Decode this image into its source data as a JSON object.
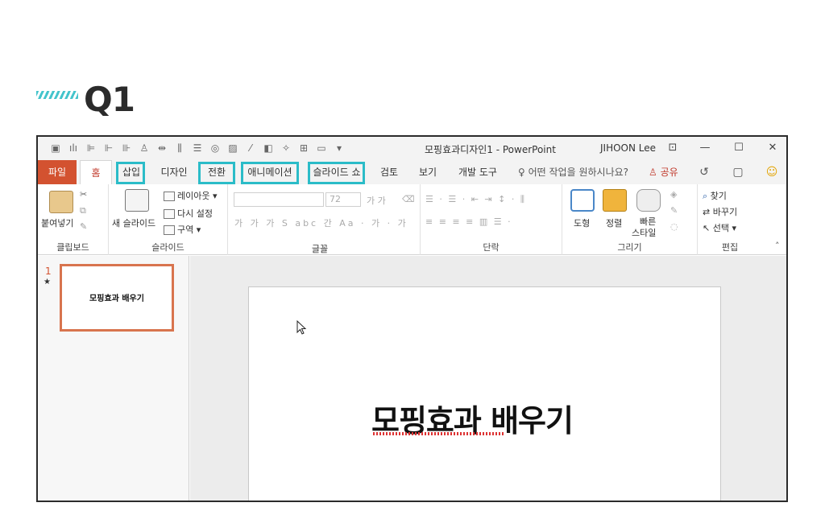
{
  "heading": {
    "title": "Q1"
  },
  "window": {
    "doc_title": "모핑효과디자인1  -  PowerPoint",
    "user": "JIHOON Lee",
    "controls": {
      "minimize": "—",
      "maximize": "☐",
      "close": "✕"
    }
  },
  "tabs": {
    "file": "파일",
    "home": "홈",
    "insert": "삽입",
    "design": "디자인",
    "transitions": "전환",
    "animations": "애니메이션",
    "slideshow": "슬라이드 쇼",
    "review": "검토",
    "view": "보기",
    "developer": "개발 도구",
    "tellme": "어떤 작업을 원하시나요?",
    "share": "공유"
  },
  "ribbon": {
    "clipboard": {
      "paste": "붙여넣기",
      "label": "클립보드"
    },
    "slides": {
      "new_slide": "새 슬라이드",
      "layout": "레이아웃 ▾",
      "reset": "다시 설정",
      "section": "구역 ▾",
      "label": "슬라이드"
    },
    "font": {
      "size": "72",
      "label": "글꼴"
    },
    "paragraph": {
      "label": "단락"
    },
    "drawing": {
      "shapes": "도형",
      "arrange": "정렬",
      "quick_styles_1": "빠른",
      "quick_styles_2": "스타일",
      "label": "그리기"
    },
    "editing": {
      "find": "찾기",
      "replace": "바꾸기",
      "select": "선택 ▾",
      "label": "편집"
    }
  },
  "thumbnail": {
    "number": "1",
    "star": "★",
    "text": "모핑효과 배우기"
  },
  "slide": {
    "title": "모핑효과 배우기"
  },
  "colors": {
    "accent_highlight": "#2bbcc8",
    "file_tab": "#d35230",
    "thumb_border": "#d8744e"
  }
}
